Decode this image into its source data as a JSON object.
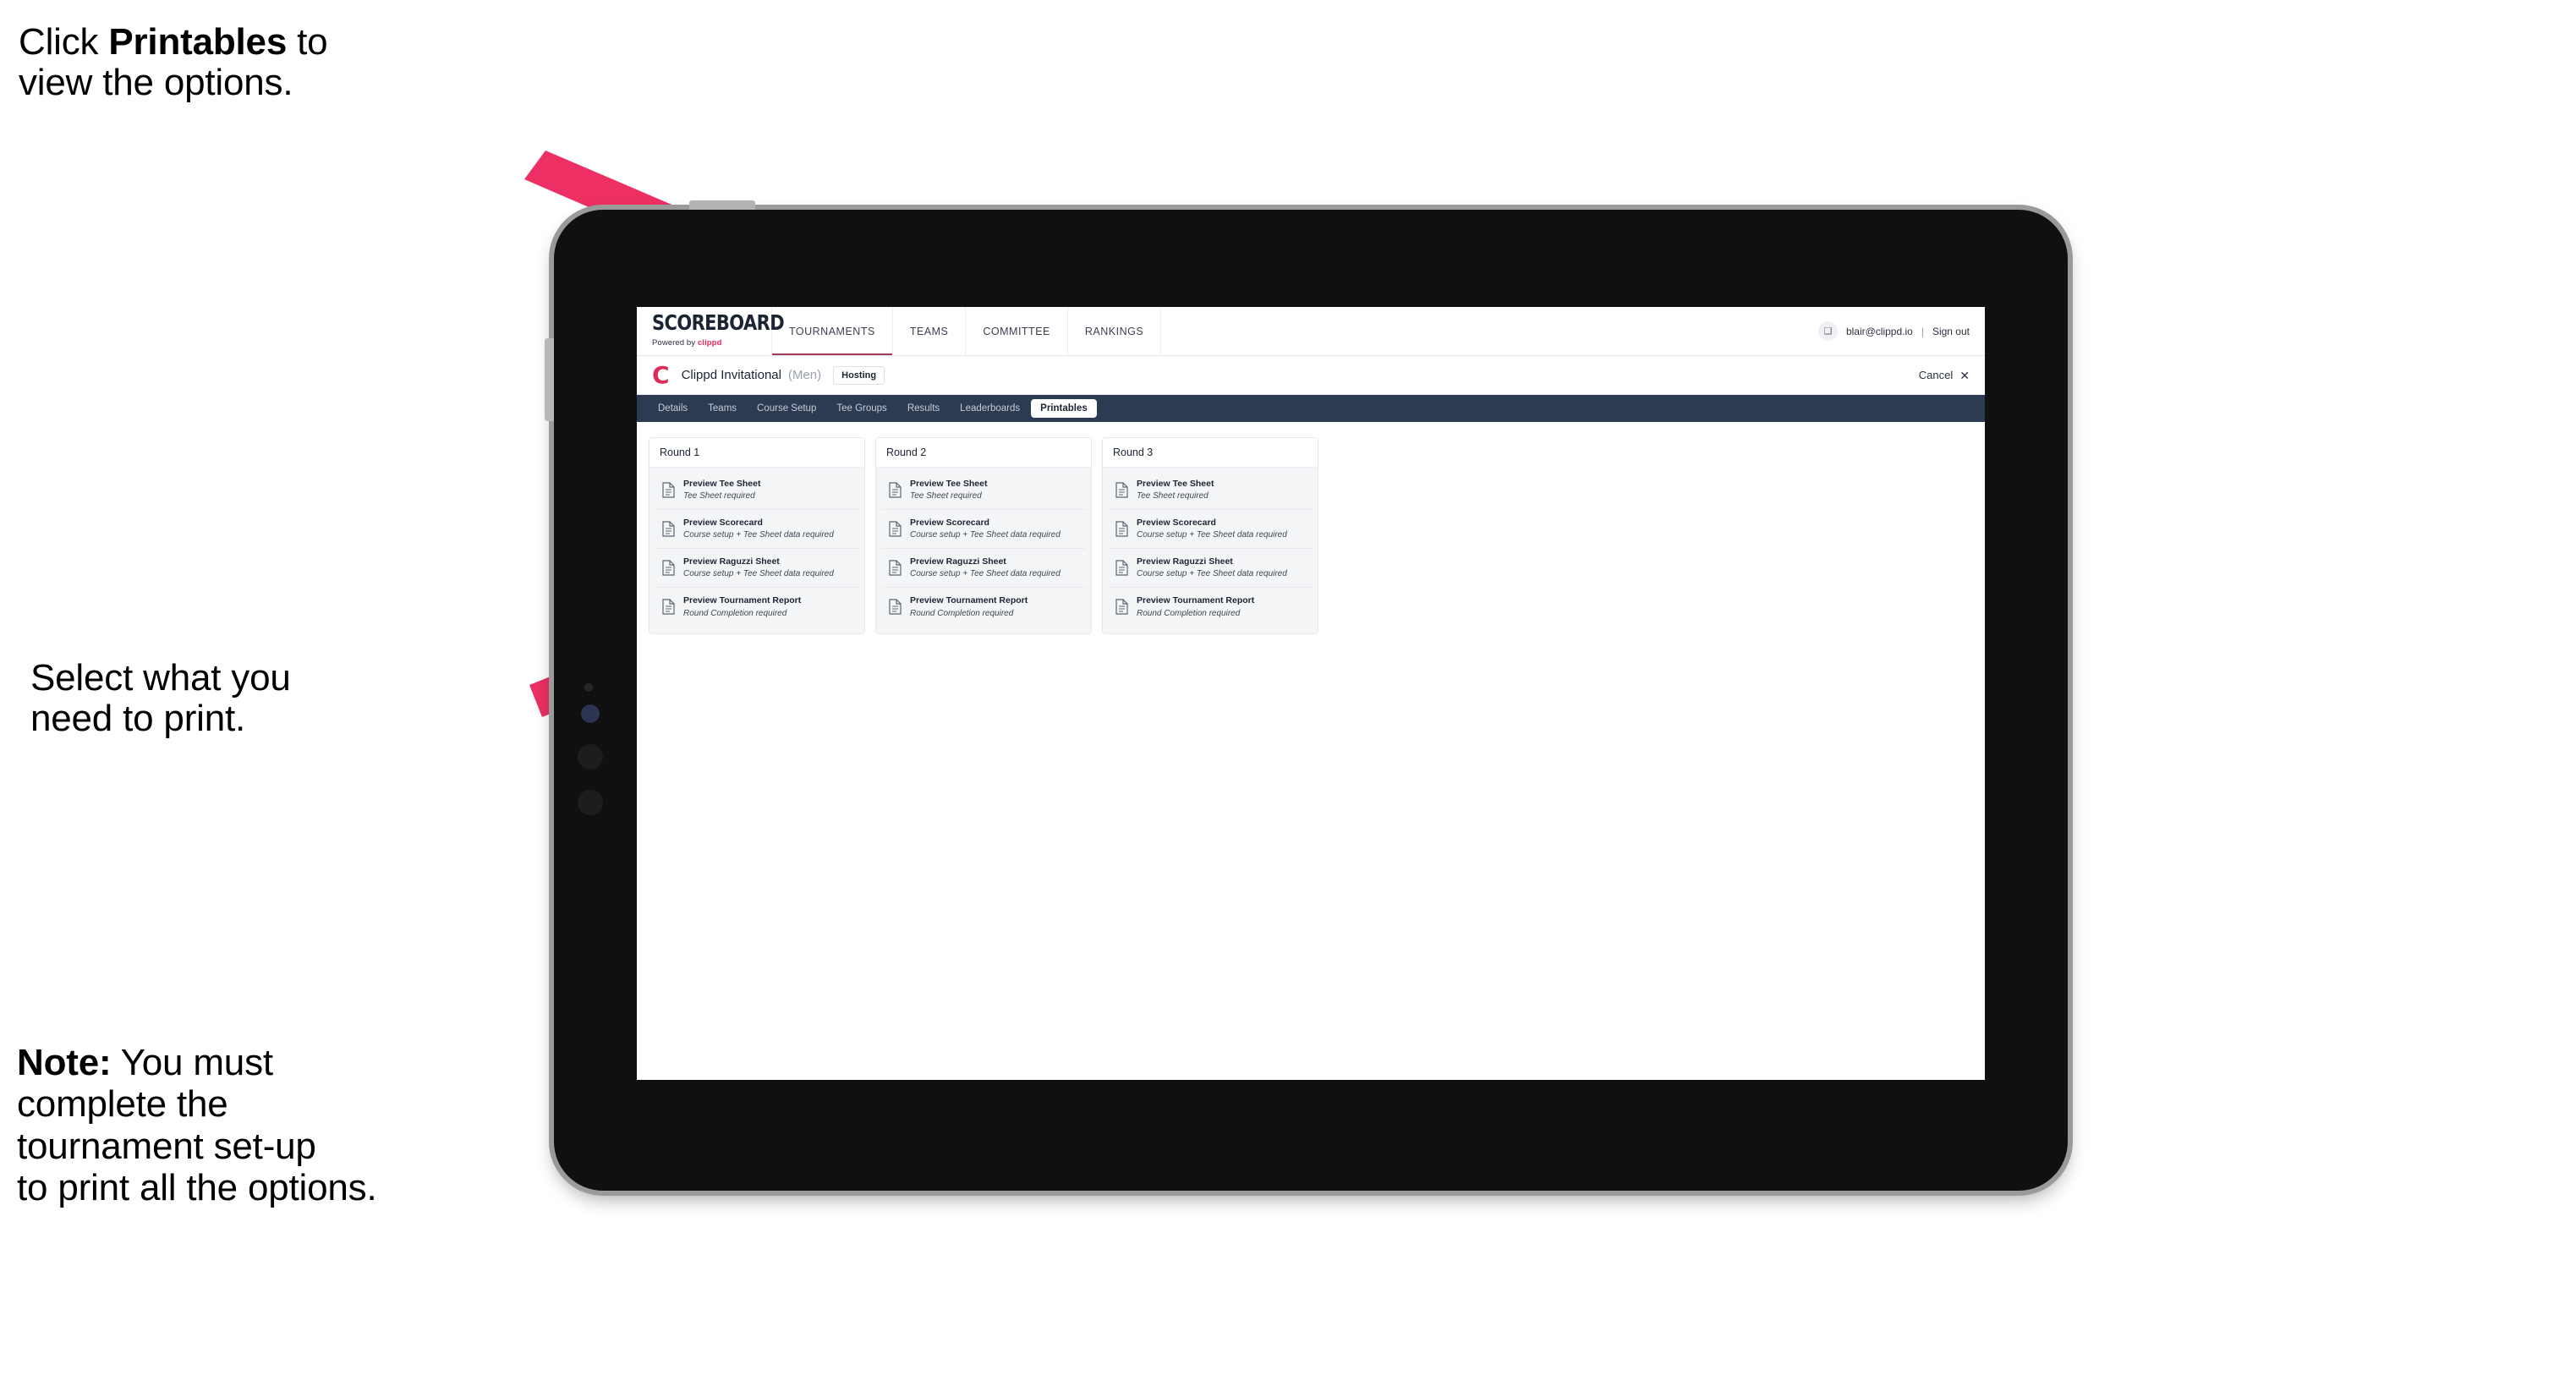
{
  "annotations": {
    "click_printables": "Click Printables to view the options.",
    "click_printables_bold": "Printables",
    "click_printables_pre": "Click ",
    "click_printables_post": " to\nview the options.",
    "select_print": "Select what you\n need to print.",
    "note_bold": "Note:",
    "note_rest": " You must\ncomplete the\ntournament set-up\nto print all the options."
  },
  "colors": {
    "arrow_pink": "#ED2F63",
    "nav_dark": "#2C3A52",
    "brand_pink": "#E8275A",
    "tablet_body": "#101010",
    "tablet_bezel": "#9A9A9A"
  },
  "app": {
    "logo": {
      "word": "SCOREBOARD",
      "powered_by": "Powered by ",
      "brand": "clippd"
    },
    "top_nav": [
      {
        "label": "TOURNAMENTS",
        "active": true
      },
      {
        "label": "TEAMS",
        "active": false
      },
      {
        "label": "COMMITTEE",
        "active": false
      },
      {
        "label": "RANKINGS",
        "active": false
      }
    ],
    "account": {
      "avatar_glyph": "❑",
      "email": "blair@clippd.io",
      "pipe": "|",
      "sign_out": "Sign out"
    },
    "tournament": {
      "logo_letter": "C",
      "name": "Clippd Invitational",
      "gender": "(Men)",
      "status_badge": "Hosting",
      "cancel_label": "Cancel",
      "cancel_icon": "✕"
    },
    "tabs": [
      {
        "label": "Details",
        "active": false
      },
      {
        "label": "Teams",
        "active": false
      },
      {
        "label": "Course Setup",
        "active": false
      },
      {
        "label": "Tee Groups",
        "active": false
      },
      {
        "label": "Results",
        "active": false
      },
      {
        "label": "Leaderboards",
        "active": false
      },
      {
        "label": "Printables",
        "active": true
      }
    ],
    "rounds": [
      {
        "title": "Round 1",
        "items": [
          {
            "title": "Preview Tee Sheet",
            "subtitle": "Tee Sheet required"
          },
          {
            "title": "Preview Scorecard",
            "subtitle": "Course setup + Tee Sheet data required"
          },
          {
            "title": "Preview Raguzzi Sheet",
            "subtitle": "Course setup + Tee Sheet data required"
          },
          {
            "title": "Preview Tournament Report",
            "subtitle": "Round Completion required"
          }
        ]
      },
      {
        "title": "Round 2",
        "items": [
          {
            "title": "Preview Tee Sheet",
            "subtitle": "Tee Sheet required"
          },
          {
            "title": "Preview Scorecard",
            "subtitle": "Course setup + Tee Sheet data required"
          },
          {
            "title": "Preview Raguzzi Sheet",
            "subtitle": "Course setup + Tee Sheet data required"
          },
          {
            "title": "Preview Tournament Report",
            "subtitle": "Round Completion required"
          }
        ]
      },
      {
        "title": "Round 3",
        "items": [
          {
            "title": "Preview Tee Sheet",
            "subtitle": "Tee Sheet required"
          },
          {
            "title": "Preview Scorecard",
            "subtitle": "Course setup + Tee Sheet data required"
          },
          {
            "title": "Preview Raguzzi Sheet",
            "subtitle": "Course setup + Tee Sheet data required"
          },
          {
            "title": "Preview Tournament Report",
            "subtitle": "Round Completion required"
          }
        ]
      }
    ]
  }
}
